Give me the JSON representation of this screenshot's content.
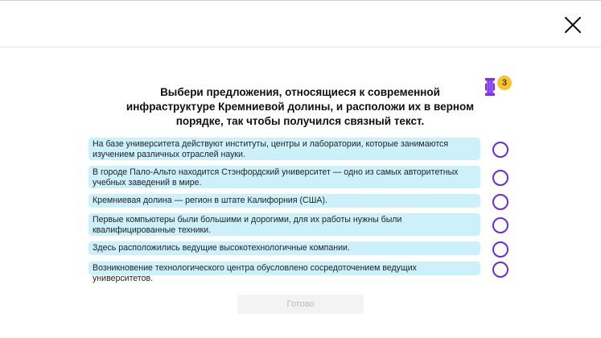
{
  "header": {
    "close_icon": "close-icon"
  },
  "task": {
    "title": "Выбери предложения, относящиеся к современной инфраструктуре Кремниевой долины, и расположи их в верном порядке, так чтобы получился связный текст.",
    "ticket_icon": "ticket-icon",
    "ticket_count": "3",
    "ticket_color": "#7b2ff2",
    "badge_color": "#f4c431"
  },
  "options": [
    {
      "text": "На базе университета действуют институты, центры и лаборатории, которые занимаются изучением различных отраслей науки."
    },
    {
      "text": "В городе Пало-Альто находится Стэнфордский университет — одно из самых авторитетных учебных заведений в мире."
    },
    {
      "text": "Кремниевая долина — регион в штате Калифорния (США)."
    },
    {
      "text": "Первые компьютеры были большими и дорогими, для их работы нужны были квалифицированные техники."
    },
    {
      "text": "Здесь расположились ведущие высокотехнологичные компании."
    },
    {
      "text": "Возникновение технологического центра обусловлено сосредоточением ведущих университетов."
    }
  ],
  "colors": {
    "card_background": "#cdf1fb",
    "radio_border": "#6c2bd9"
  },
  "footer": {
    "done_label": "Готово"
  }
}
